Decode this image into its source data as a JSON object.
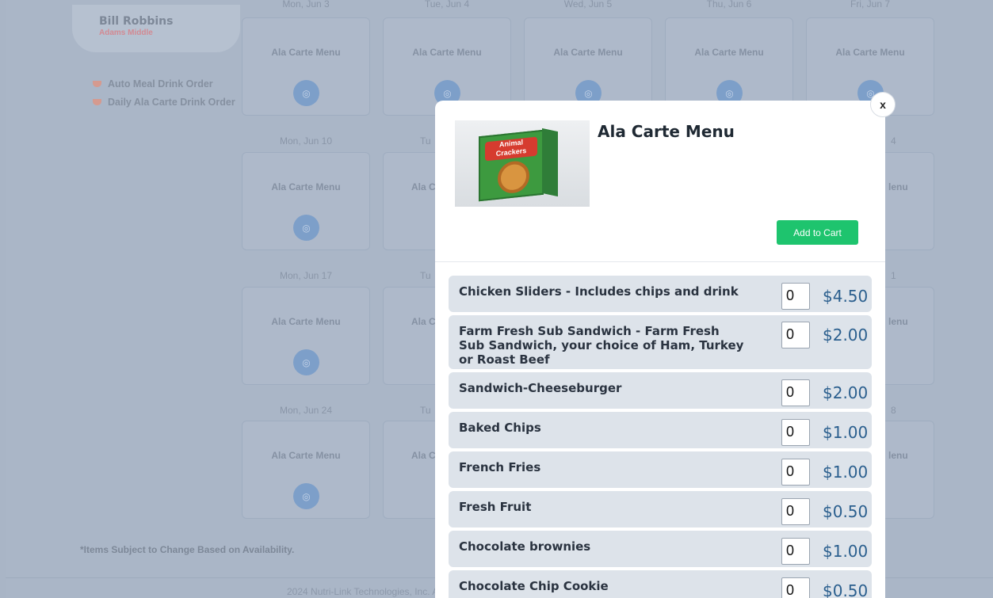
{
  "user": {
    "name": "Bill Robbins",
    "school": "Adams Middle"
  },
  "side_links": [
    {
      "label": "Auto Meal Drink Order",
      "icon": "cup-icon"
    },
    {
      "label": "Daily Ala Carte Drink Order",
      "icon": "cup-icon"
    }
  ],
  "calendar": {
    "menu_label": "Ala Carte Menu",
    "top_labels": [
      "Mon, Jun 3",
      "Tue, Jun 4",
      "Wed, Jun 5",
      "Thu, Jun 6",
      "Fri, Jun 7"
    ],
    "row_labels_left": [
      "Mon, Jun 10",
      "Mon, Jun 17",
      "Mon, Jun 24"
    ],
    "row_labels_second": [
      "Tu",
      "Tu",
      "Tu"
    ],
    "row_labels_right": [
      "4",
      "1",
      "8"
    ],
    "partial_menu_left": "Ala C",
    "partial_menu_right": "lenu"
  },
  "disclaimer": "*Items Subject to Change Based on Availability.",
  "footer": "2024 Nutri-Link Technologies, Inc. A",
  "modal": {
    "title": "Ala Carte Menu",
    "close_label": "x",
    "add_to_cart": "Add to Cart",
    "image_text": "Animal Crackers",
    "items": [
      {
        "name": "Chicken Sliders - Includes chips and drink",
        "qty": "0",
        "price": "$4.50"
      },
      {
        "name": "Farm Fresh Sub Sandwich - Farm Fresh Sub Sandwich, your choice of Ham, Turkey or Roast Beef",
        "qty": "0",
        "price": "$2.00"
      },
      {
        "name": "Sandwich-Cheeseburger",
        "qty": "0",
        "price": "$2.00"
      },
      {
        "name": "Baked Chips",
        "qty": "0",
        "price": "$1.00"
      },
      {
        "name": "French Fries",
        "qty": "0",
        "price": "$1.00"
      },
      {
        "name": "Fresh Fruit",
        "qty": "0",
        "price": "$0.50"
      },
      {
        "name": "Chocolate brownies",
        "qty": "0",
        "price": "$1.00"
      },
      {
        "name": "Chocolate Chip Cookie",
        "qty": "0",
        "price": "$0.50"
      }
    ]
  }
}
